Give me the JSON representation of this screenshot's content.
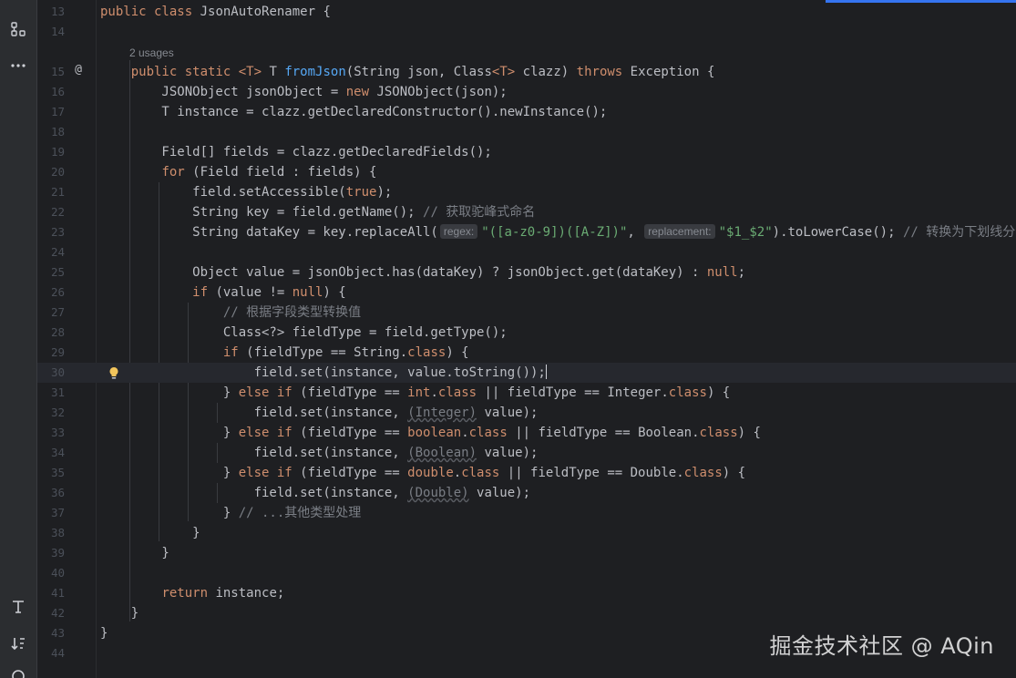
{
  "editor": {
    "usages_label": "2 usages",
    "lines": [
      {
        "n": "13",
        "code": "<span class='kw'>public class</span> JsonAutoRenamer {"
      },
      {
        "n": "14",
        "code": ""
      },
      {
        "n": "15",
        "code": "    <span class='kw'>public static</span> <span class='kw'>&lt;T&gt;</span> T <span class='fn'>fromJson</span>(String json, Class<span class='kw'>&lt;T&gt;</span> clazz) <span class='kw'>throws</span> Exception {"
      },
      {
        "n": "16",
        "code": "        JSONObject jsonObject = <span class='kw'>new</span> JSONObject(json);"
      },
      {
        "n": "17",
        "code": "        T instance = clazz.getDeclaredConstructor().newInstance();"
      },
      {
        "n": "18",
        "code": ""
      },
      {
        "n": "19",
        "code": "        Field[] fields = clazz.getDeclaredFields();"
      },
      {
        "n": "20",
        "code": "        <span class='kw'>for</span> (Field field : fields) {"
      },
      {
        "n": "21",
        "code": "            field.setAccessible(<span class='kw'>true</span>);"
      },
      {
        "n": "22",
        "code": "            String key = field.getName(); <span class='cm'>// 获取驼峰式命名</span>"
      },
      {
        "n": "23",
        "code": "            String dataKey = key.replaceAll(<span class='hint'>regex:</span><span class='str'>\"([a-z0-9])([A-Z])\"</span>, <span class='hint'>replacement:</span><span class='str'>\"$1_$2\"</span>).toLowerCase(); <span class='cm'>// 转换为下划线分隔</span>"
      },
      {
        "n": "24",
        "code": ""
      },
      {
        "n": "25",
        "code": "            Object value = jsonObject.has(dataKey) ? jsonObject.get(dataKey) : <span class='kw'>null</span>;"
      },
      {
        "n": "26",
        "code": "            <span class='kw'>if</span> (value != <span class='kw'>null</span>) {"
      },
      {
        "n": "27",
        "code": "                <span class='cm'>// 根据字段类型转换值</span>"
      },
      {
        "n": "28",
        "code": "                Class&lt;?&gt; fieldType = field.getType();"
      },
      {
        "n": "29",
        "code": "                <span class='kw'>if</span> (fieldType == String.<span class='kw'>class</span>) {"
      },
      {
        "n": "30",
        "code": "                    field.set(instance, value.toString());<span class='caret'></span>"
      },
      {
        "n": "31",
        "code": "                } <span class='kw'>else if</span> (fieldType == <span class='kw'>int</span>.<span class='kw'>class</span> || fieldType == Integer.<span class='kw'>class</span>) {"
      },
      {
        "n": "32",
        "code": "                    field.set(instance, <span class='cast'>(Integer)</span> value);"
      },
      {
        "n": "33",
        "code": "                } <span class='kw'>else if</span> (fieldType == <span class='kw'>boolean</span>.<span class='kw'>class</span> || fieldType == Boolean.<span class='kw'>class</span>) {"
      },
      {
        "n": "34",
        "code": "                    field.set(instance, <span class='cast'>(Boolean)</span> value);"
      },
      {
        "n": "35",
        "code": "                } <span class='kw'>else if</span> (fieldType == <span class='kw'>double</span>.<span class='kw'>class</span> || fieldType == Double.<span class='kw'>class</span>) {"
      },
      {
        "n": "36",
        "code": "                    field.set(instance, <span class='cast'>(Double)</span> value);"
      },
      {
        "n": "37",
        "code": "                } <span class='cm'>// ...其他类型处理</span>"
      },
      {
        "n": "38",
        "code": "            }"
      },
      {
        "n": "39",
        "code": "        }"
      },
      {
        "n": "40",
        "code": ""
      },
      {
        "n": "41",
        "code": "        <span class='kw'>return</span> instance;"
      },
      {
        "n": "42",
        "code": "    }"
      },
      {
        "n": "43",
        "code": "}"
      },
      {
        "n": "44",
        "code": ""
      }
    ]
  },
  "toolbar": {
    "top_icons": [
      "structure-icon",
      "more-icon"
    ],
    "bottom_icons": [
      "text-format-icon",
      "sort-icon"
    ]
  },
  "watermark": "掘金技术社区 @ AQin",
  "colors": {
    "background": "#1e1f22",
    "keyword": "#cf8e6d",
    "function": "#56a8f5",
    "string": "#6aab73",
    "comment": "#7a7e85",
    "accent": "#3574f0"
  }
}
